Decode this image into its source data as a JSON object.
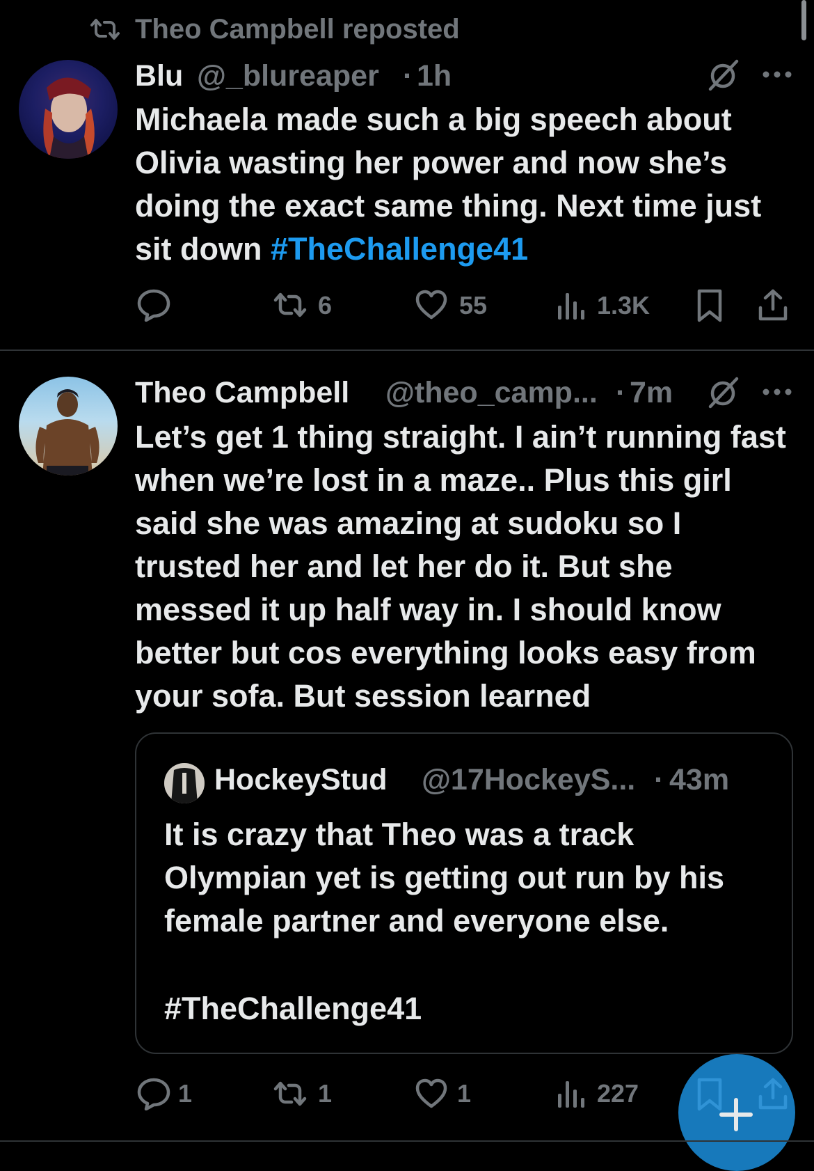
{
  "scrollbar": {
    "visible": true
  },
  "repost_banner": {
    "text": "Theo Campbell reposted",
    "icon": "repost-icon"
  },
  "tweet1": {
    "display_name": "Blu",
    "handle": "@_blureaper",
    "dot": "·",
    "time": "1h",
    "text_parts": {
      "plain": "Michaela made such a big speech about Olivia wasting her power and now she’s doing the exact same thing. Next time just sit down ",
      "hashtag": "#TheChallenge41"
    },
    "actions": {
      "reply_count": "",
      "repost_count": "6",
      "like_count": "55",
      "views_count": "1.3K"
    },
    "icons": [
      "grok-icon",
      "more-icon",
      "reply-icon",
      "repost-icon",
      "like-icon",
      "views-icon",
      "bookmark-icon",
      "share-icon"
    ]
  },
  "tweet2": {
    "display_name": "Theo Campbell",
    "handle": "@theo_camp...",
    "dot": "·",
    "time": "7m",
    "text": "Let’s get 1 thing straight. I ain’t running fast when we’re lost in a maze.. Plus this girl said she was amazing at sudoku so I trusted her and let her do it. But she messed it up half way in. I should know better but cos everything looks easy from your sofa. But session learned",
    "quote": {
      "display_name": "HockeyStud",
      "handle": "@17HockeyS...",
      "dot": "·",
      "time": "43m",
      "text": "It is crazy that Theo was a track Olympian yet is getting out run by his female partner and everyone else.",
      "hashtag": "#TheChallenge41"
    },
    "actions": {
      "reply_count": "1",
      "repost_count": "1",
      "like_count": "1",
      "views_count": "227"
    }
  },
  "fab": {
    "icon": "compose-plus-icon"
  },
  "colors": {
    "background": "#000000",
    "text": "#e7e9ea",
    "muted": "#71767b",
    "link": "#1d9bf0",
    "fab": "#1d9bf0"
  }
}
